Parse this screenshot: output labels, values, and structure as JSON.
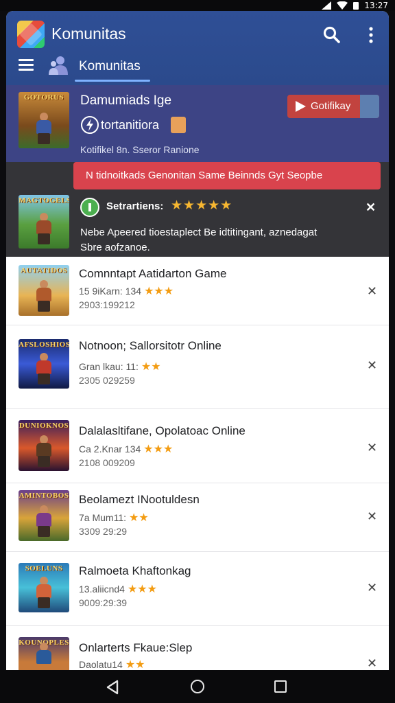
{
  "status_bar": {
    "time": "13:27"
  },
  "app_bar": {
    "title": "Komunitas",
    "tab_label": "Komunitas",
    "icons": [
      "app-logo-icon",
      "search-icon",
      "more-vert-icon",
      "menu-icon",
      "community-tab-icon"
    ]
  },
  "featured_primary": {
    "thumb_banner": "GOTORUS",
    "title": "Damumiads Ige",
    "subtitle": "tortanitiora",
    "meta": "Kotifikel 8n. Sseror Ranione",
    "action_label": "Gotifikay"
  },
  "featured_secondary": {
    "thumb_banner": "MAGTOGELS",
    "alert": "N tidnoitkads Genonitan Same Beinnds Gyt Seopbe",
    "rating_label": "Setrartiens:",
    "rating_stars": "★★★★★",
    "description": "Nebe Apeered tioestaplect Be idtitingant, aznedagat Sbre aofzanoe."
  },
  "list": [
    {
      "banner": "AUTATIDOS",
      "title": "Comnntapt Aatidarton Game",
      "line2": "15 9iKarn: 134",
      "stars": "★★★",
      "line3": "2903:199212"
    },
    {
      "banner": "AFSLOSHIOS",
      "title": "Notnoon; Sallorsitotr Online",
      "line2": "Gran lkau: 11:",
      "stars": "★★",
      "line3": "2305 029259"
    },
    {
      "banner": "DUNIOKNOS",
      "title": "Dalalasltifane, Opolatoac Online",
      "line2": "Ca 2.Knar 134",
      "stars": "★★★",
      "line3": "2108 009209"
    },
    {
      "banner": "AMINTOBOS",
      "title": "Beolamezt INootuldesn",
      "line2": "7a Mum11:",
      "stars": "★★",
      "line3": "3309 29:29"
    },
    {
      "banner": "SOELUNS",
      "title": "Ralmoeta Khaftonkag",
      "line2": "13.aliicnd4",
      "stars": "★★★",
      "line3": "9009:29:39"
    },
    {
      "banner": "KOUNOPLES",
      "title": "Onlarterts Fkaue:Slep",
      "line2": "Daolatu14",
      "stars": "★★",
      "line3": ""
    }
  ],
  "nav_bar": {
    "icons": [
      "back-icon",
      "home-icon",
      "recents-icon"
    ]
  },
  "colors": {
    "app_bar": "#2f4f96",
    "featured_primary_bg": "#3d4485",
    "featured_secondary_bg": "#343438",
    "alert": "#d9434d",
    "action_button": "#c2433f",
    "tab_indicator": "#7fb2ff",
    "star": "#f39c12"
  }
}
